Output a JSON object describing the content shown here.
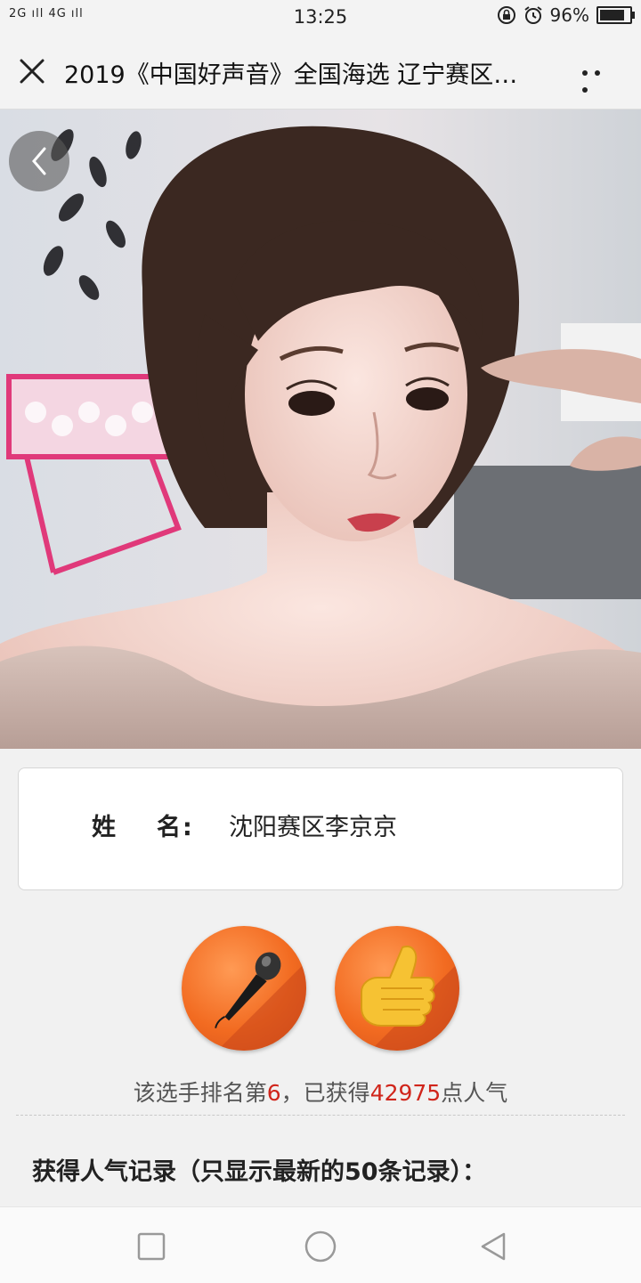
{
  "status_bar": {
    "signal_text": "2G ıll 4G ıll",
    "time": "13:25",
    "battery_percent": "96%",
    "battery_level": 0.96
  },
  "title_bar": {
    "title": "2019《中国好声音》全国海选 辽宁赛区…"
  },
  "contestant": {
    "name_label": [
      "姓",
      "名:"
    ],
    "name_value": "沈阳赛区李京京"
  },
  "actions": {
    "vote_icon": "microphone-icon",
    "like_icon": "thumbs-up-icon"
  },
  "ranking": {
    "prefix": "该选手排名第",
    "rank": "6",
    "middle": "，已获得",
    "votes": "42975",
    "suffix": "点人气"
  },
  "records": {
    "heading": "获得人气记录（只显示最新的50条记录）："
  },
  "colors": {
    "highlight": "#d0251b",
    "button_orange": "#f26b21"
  }
}
